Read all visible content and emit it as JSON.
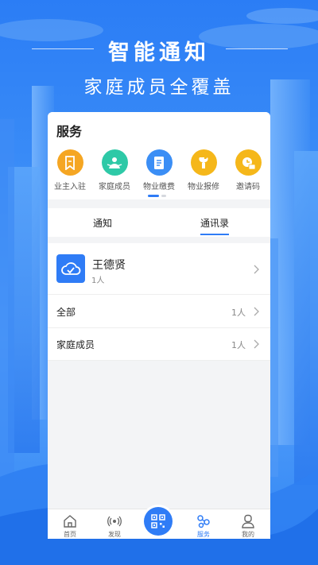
{
  "promo": {
    "headline": "智能通知",
    "subheadline": "家庭成员全覆盖"
  },
  "services": {
    "title": "服务",
    "items": [
      {
        "label": "业主入驻",
        "icon": "bookmark-icon",
        "color": "#f5a623"
      },
      {
        "label": "家庭成员",
        "icon": "family-icon",
        "color": "#2ec9a7"
      },
      {
        "label": "物业缴费",
        "icon": "bill-icon",
        "color": "#3b8ef5"
      },
      {
        "label": "物业报修",
        "icon": "wrench-icon",
        "color": "#f5b71a"
      },
      {
        "label": "邀请码",
        "icon": "invite-code-icon",
        "color": "#f5b71a"
      }
    ]
  },
  "tabs": {
    "notice": "通知",
    "contacts": "通讯录",
    "active": "contacts"
  },
  "contacts": {
    "name": "王德贤",
    "count": "1人",
    "groups": [
      {
        "label": "全部",
        "count": "1人"
      },
      {
        "label": "家庭成员",
        "count": "1人"
      }
    ]
  },
  "tabbar": {
    "items": [
      {
        "label": "首页",
        "icon": "home-icon"
      },
      {
        "label": "发现",
        "icon": "broadcast-icon"
      },
      {
        "label": "服务",
        "icon": "service-icon",
        "active": true
      },
      {
        "label": "我的",
        "icon": "profile-icon"
      }
    ],
    "center": "qr-scan-icon"
  },
  "colors": {
    "accent": "#2f7cf6",
    "background": "#2b7df5"
  }
}
